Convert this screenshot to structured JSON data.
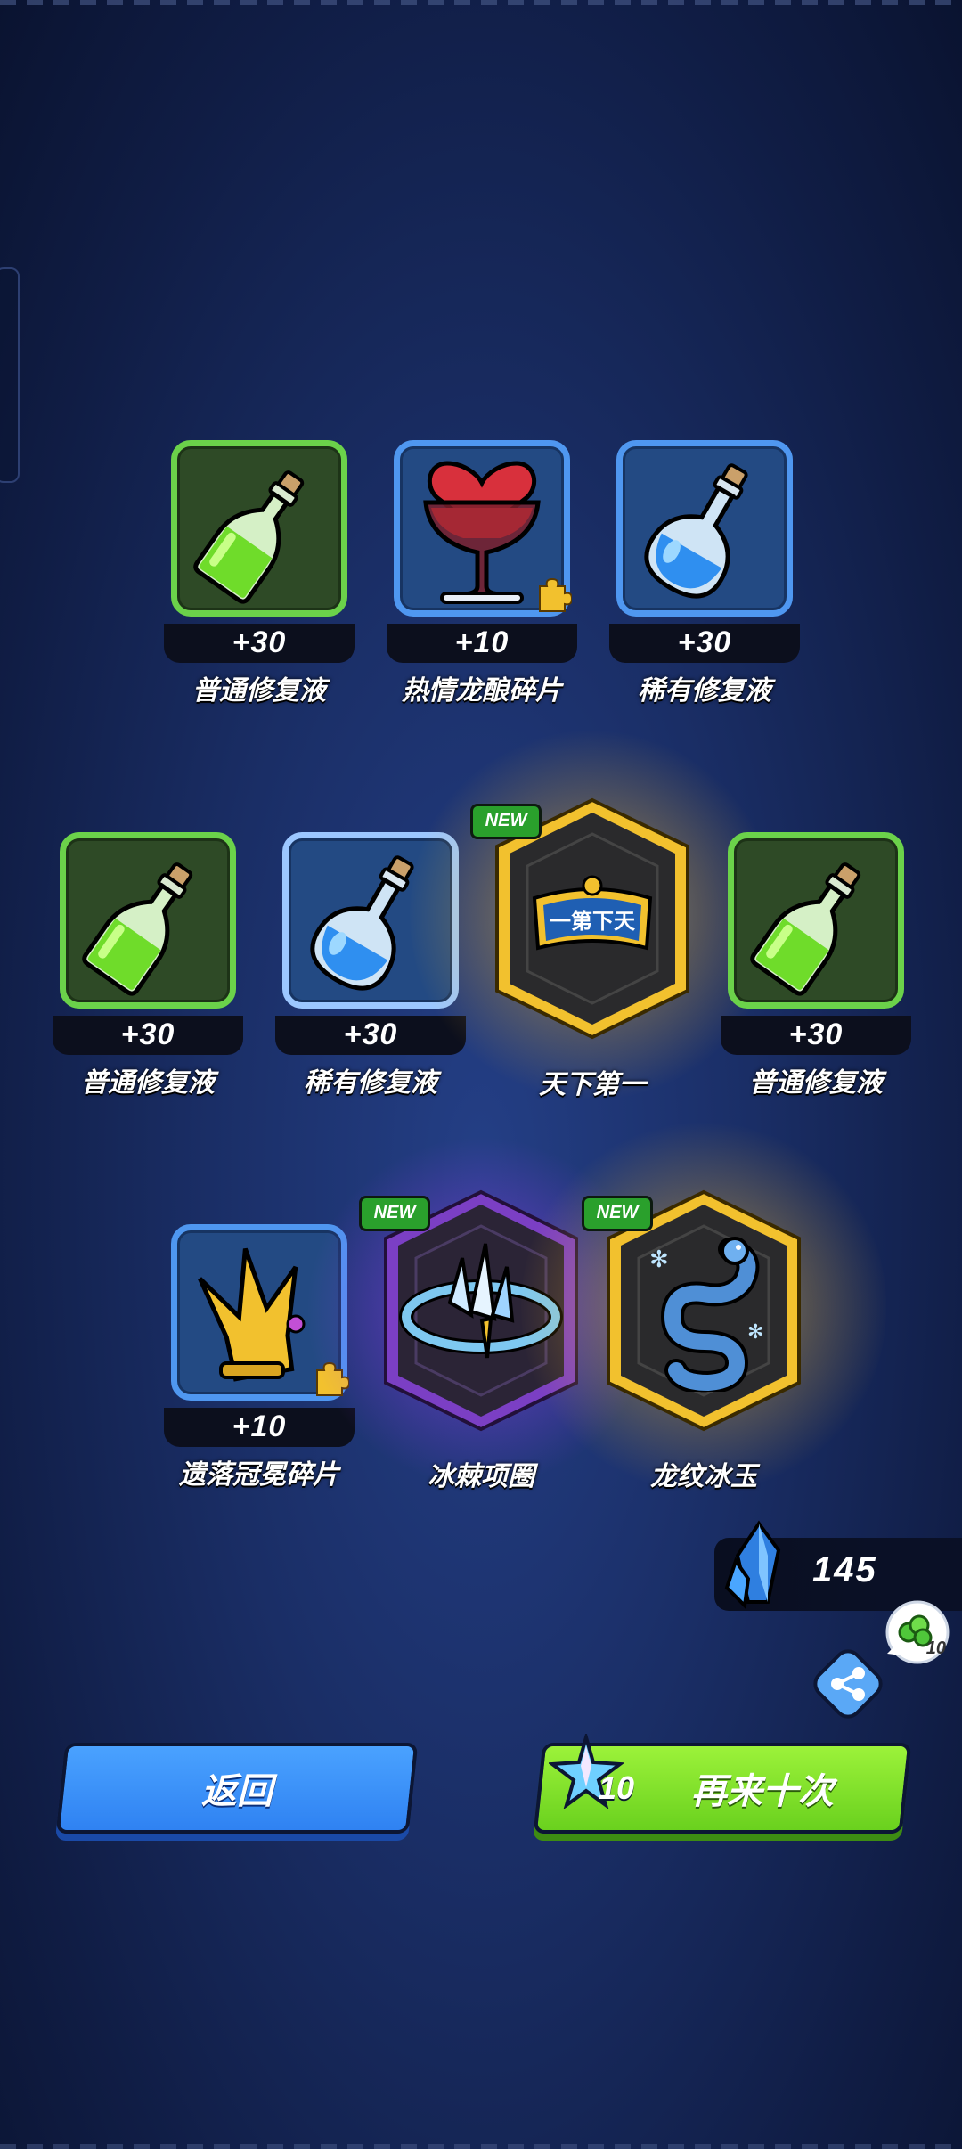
{
  "row1": [
    {
      "name": "普通修复液",
      "count": "+30",
      "rarity": "green",
      "icon": "green-potion-icon"
    },
    {
      "name": "热情龙酿碎片",
      "count": "+10",
      "rarity": "blue",
      "icon": "heart-cocktail-icon",
      "fragment": true
    },
    {
      "name": "稀有修复液",
      "count": "+30",
      "rarity": "blue",
      "icon": "blue-potion-icon"
    }
  ],
  "row2": [
    {
      "name": "普通修复液",
      "count": "+30",
      "rarity": "green",
      "icon": "green-potion-icon"
    },
    {
      "name": "稀有修复液",
      "count": "+30",
      "rarity": "blue",
      "icon": "blue-potion-icon"
    },
    {
      "name": "天下第一",
      "badge": "NEW",
      "rarity": "gold",
      "icon": "title-plaque-icon",
      "plaque_text": "一第下天"
    },
    {
      "name": "普通修复液",
      "count": "+30",
      "rarity": "green",
      "icon": "green-potion-icon"
    }
  ],
  "row3": [
    {
      "name": "遗落冠冕碎片",
      "count": "+10",
      "rarity": "blue",
      "icon": "crown-icon",
      "fragment": true
    },
    {
      "name": "冰棘项圈",
      "badge": "NEW",
      "rarity": "purple",
      "icon": "spiked-collar-icon"
    },
    {
      "name": "龙纹冰玉",
      "badge": "NEW",
      "rarity": "gold",
      "icon": "ice-dragon-icon"
    }
  ],
  "currency": {
    "amount": "145",
    "icon": "crystal-icon"
  },
  "share": {
    "icon": "share-icon",
    "bubble_count": "10"
  },
  "buttons": {
    "back": "返回",
    "again": "再来十次",
    "again_cost": "10"
  },
  "colors": {
    "green": "#6bd24a",
    "blue": "#4f97f0",
    "gold": "#f2c12e",
    "purple": "#a54df2",
    "back_button": "#3b92fa",
    "again_button": "#86e32c"
  }
}
